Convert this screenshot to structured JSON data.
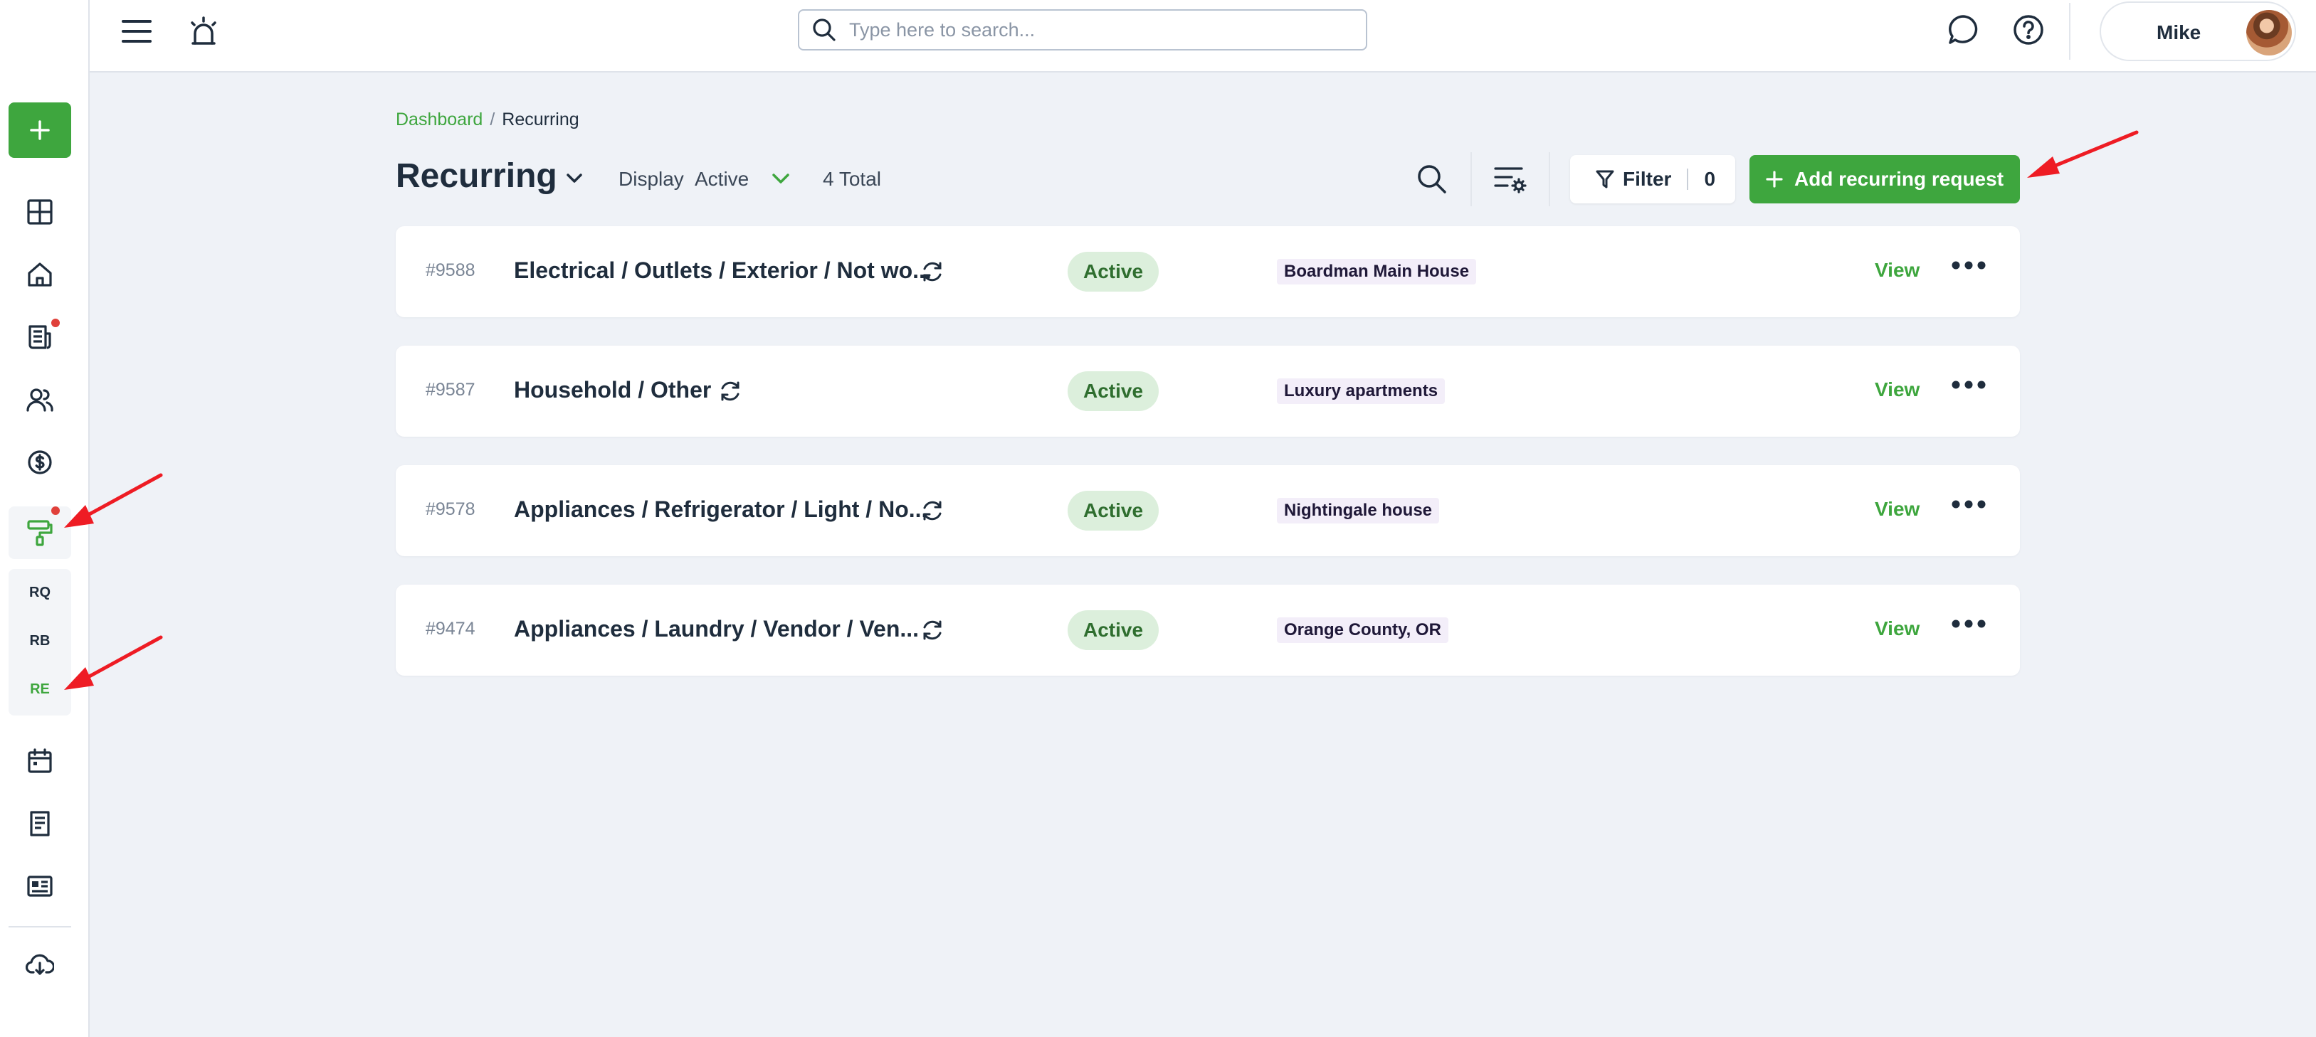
{
  "topbar": {
    "search_placeholder": "Type here to search...",
    "user_name": "Mike"
  },
  "sidebar": {
    "sub_items": [
      "RQ",
      "RB",
      "RE"
    ]
  },
  "breadcrumb": {
    "home": "Dashboard",
    "separator": "/",
    "current": "Recurring"
  },
  "header": {
    "title": "Recurring",
    "display_label": "Display",
    "display_value": "Active",
    "total": "4 Total",
    "filter_label": "Filter",
    "filter_count": "0",
    "add_button": "Add recurring request"
  },
  "rows": [
    {
      "id": "#9588",
      "title": "Electrical / Outlets / Exterior / Not wo...",
      "status": "Active",
      "property": "Boardman Main House",
      "action": "View"
    },
    {
      "id": "#9587",
      "title": "Household / Other",
      "status": "Active",
      "property": "Luxury apartments",
      "action": "View"
    },
    {
      "id": "#9578",
      "title": "Appliances / Refrigerator / Light / No...",
      "status": "Active",
      "property": "Nightingale house",
      "action": "View"
    },
    {
      "id": "#9474",
      "title": "Appliances / Laundry / Vendor / Ven...",
      "status": "Active",
      "property": "Orange County, OR",
      "action": "View"
    }
  ],
  "colors": {
    "accent": "#3ea63e",
    "background": "#eff2f7",
    "annotation_arrow": "#ee1c24"
  }
}
